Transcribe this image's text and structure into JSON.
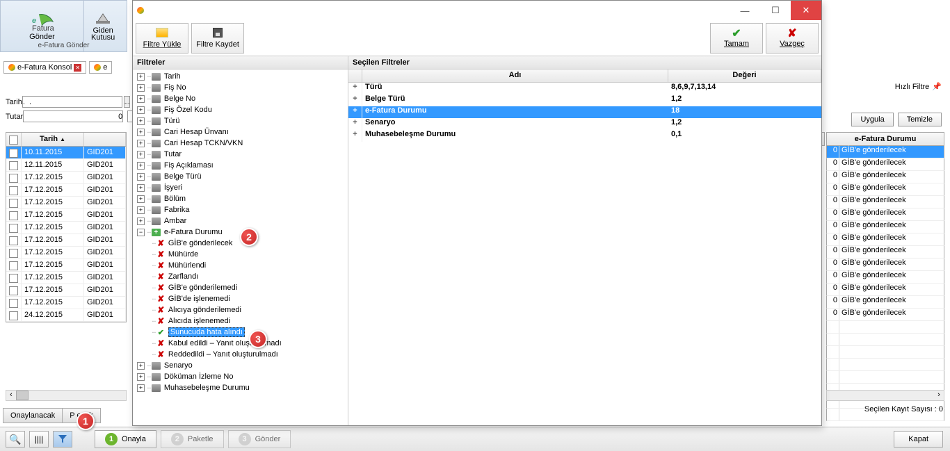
{
  "ribbon": {
    "efatura_gonder": "Gönder",
    "efatura_sub": "e-Fatura Gönder",
    "giden": "Giden",
    "kutusu": "Kutusu"
  },
  "tabs": {
    "t1": "e-Fatura Konsol"
  },
  "filters": {
    "tarih_lbl": "Tarih",
    "tutar_lbl": "Tutar"
  },
  "quick_filter_lbl": "Hızlı Filtre",
  "btn_uygula": "Uygula",
  "btn_temizle": "Temizle",
  "grid": {
    "h_tarih": "Tarih",
    "h_ef": "e-Fatura Durumu",
    "rows": [
      {
        "d": "10.11.2015",
        "c": "GID201",
        "s": "0",
        "e": "GİB'e gönderilecek",
        "sel": true
      },
      {
        "d": "12.11.2015",
        "c": "GID201",
        "s": "0",
        "e": "GİB'e gönderilecek"
      },
      {
        "d": "17.12.2015",
        "c": "GID201",
        "s": "0",
        "e": "GİB'e gönderilecek"
      },
      {
        "d": "17.12.2015",
        "c": "GID201",
        "s": "0",
        "e": "GİB'e gönderilecek"
      },
      {
        "d": "17.12.2015",
        "c": "GID201",
        "s": "0",
        "e": "GİB'e gönderilecek"
      },
      {
        "d": "17.12.2015",
        "c": "GID201",
        "s": "0",
        "e": "GİB'e gönderilecek"
      },
      {
        "d": "17.12.2015",
        "c": "GID201",
        "s": "0",
        "e": "GİB'e gönderilecek"
      },
      {
        "d": "17.12.2015",
        "c": "GID201",
        "s": "0",
        "e": "GİB'e gönderilecek"
      },
      {
        "d": "17.12.2015",
        "c": "GID201",
        "s": "0",
        "e": "GİB'e gönderilecek"
      },
      {
        "d": "17.12.2015",
        "c": "GID201",
        "s": "0",
        "e": "GİB'e gönderilecek"
      },
      {
        "d": "17.12.2015",
        "c": "GID201",
        "s": "0",
        "e": "GİB'e gönderilecek"
      },
      {
        "d": "17.12.2015",
        "c": "GID201",
        "s": "0",
        "e": "GİB'e gönderilecek"
      },
      {
        "d": "17.12.2015",
        "c": "GID201",
        "s": "0",
        "e": "GİB'e gönderilecek"
      },
      {
        "d": "24.12.2015",
        "c": "GID201",
        "s": "0",
        "e": "GİB'e gönderilecek"
      }
    ]
  },
  "status_right": "Seçilen Kayıt Sayısı : 0",
  "bottom_tabs": {
    "t1": "Onaylanacak",
    "t2": "P         ecek"
  },
  "steps": {
    "s1": "Onayla",
    "s2": "Paketle",
    "s3": "Gönder",
    "kapat": "Kapat"
  },
  "dlg": {
    "tb_load": "Filtre Yükle",
    "tb_save": "Filtre Kaydet",
    "tb_ok": "Tamam",
    "tb_cancel": "Vazgeç",
    "left_header": "Filtreler",
    "right_header": "Seçilen Filtreler",
    "sel_h_name": "Adı",
    "sel_h_val": "Değeri",
    "tree": [
      "Tarih",
      "Fiş No",
      "Belge No",
      "Fiş Özel Kodu",
      "Türü",
      "Cari Hesap Ünvanı",
      "Cari Hesap TCKN/VKN",
      "Tutar",
      "Fiş Açıklaması",
      "Belge Türü",
      "İşyeri",
      "Bölüm",
      "Fabrika",
      "Ambar"
    ],
    "tree_efatura": "e-Fatura Durumu",
    "tree_children": [
      {
        "t": "GİB'e gönderilecek",
        "x": true
      },
      {
        "t": "Mühürde",
        "x": true
      },
      {
        "t": "Mühürlendi",
        "x": true
      },
      {
        "t": "Zarflandı",
        "x": true
      },
      {
        "t": "GİB'e gönderilemedi",
        "x": true
      },
      {
        "t": "GİB'de işlenemedi",
        "x": true
      },
      {
        "t": "Alıcıya gönderilemedi",
        "x": true
      },
      {
        "t": "Alıcıda işlenemedi",
        "x": true
      },
      {
        "t": "Sunucuda hata alındı",
        "x": false,
        "sel": true
      },
      {
        "t": "Kabul edildi – Yanıt oluşturulmadı",
        "x": true
      },
      {
        "t": "Reddedildi – Yanıt oluşturulmadı",
        "x": true
      }
    ],
    "tree_after": [
      "Senaryo",
      "Döküman İzleme No",
      "Muhasebeleşme Durumu"
    ],
    "sel_rows": [
      {
        "n": "Türü",
        "v": "8,6,9,7,13,14"
      },
      {
        "n": "Belge Türü",
        "v": "1,2"
      },
      {
        "n": "e-Fatura Durumu",
        "v": "18",
        "hl": true
      },
      {
        "n": "Senaryo",
        "v": "1,2"
      },
      {
        "n": "Muhasebeleşme Durumu",
        "v": "0,1"
      }
    ]
  }
}
